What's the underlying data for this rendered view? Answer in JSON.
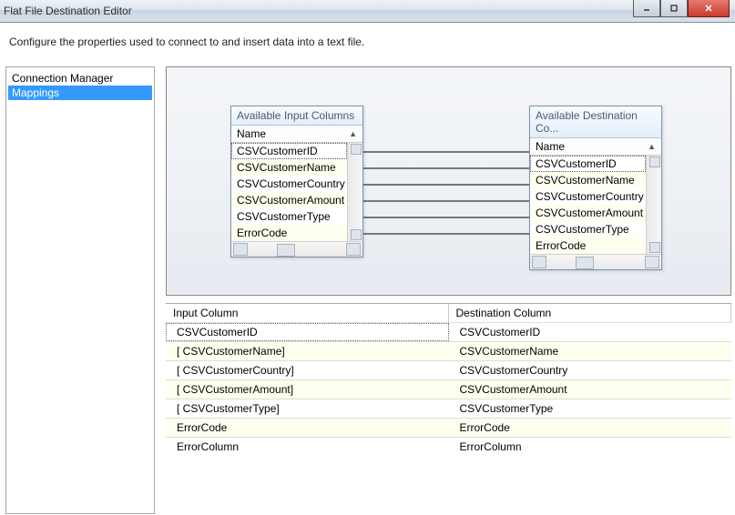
{
  "window": {
    "title": "Flat File Destination Editor"
  },
  "subtitle": "Configure the properties used to connect to and insert data into a text file.",
  "nav": {
    "items": [
      "Connection Manager",
      "Mappings"
    ],
    "selected": "Mappings"
  },
  "inputBox": {
    "title": "Available Input Columns",
    "header": "Name",
    "rows": [
      "CSVCustomerID",
      "CSVCustomerName",
      "CSVCustomerCountry",
      "CSVCustomerAmount",
      "CSVCustomerType",
      "ErrorCode"
    ]
  },
  "destBox": {
    "title": "Available Destination Co...",
    "header": "Name",
    "rows": [
      "CSVCustomerID",
      "CSVCustomerName",
      "CSVCustomerCountry",
      "CSVCustomerAmount",
      "CSVCustomerType",
      "ErrorCode"
    ]
  },
  "grid": {
    "headers": [
      "Input Column",
      "Destination Column"
    ],
    "rows": [
      {
        "in": "CSVCustomerID",
        "out": "CSVCustomerID"
      },
      {
        "in": "[ CSVCustomerName]",
        "out": "CSVCustomerName"
      },
      {
        "in": "[ CSVCustomerCountry]",
        "out": "CSVCustomerCountry"
      },
      {
        "in": "[ CSVCustomerAmount]",
        "out": "CSVCustomerAmount"
      },
      {
        "in": "[ CSVCustomerType]",
        "out": "CSVCustomerType"
      },
      {
        "in": "ErrorCode",
        "out": "ErrorCode"
      },
      {
        "in": "ErrorColumn",
        "out": "ErrorColumn"
      }
    ]
  }
}
